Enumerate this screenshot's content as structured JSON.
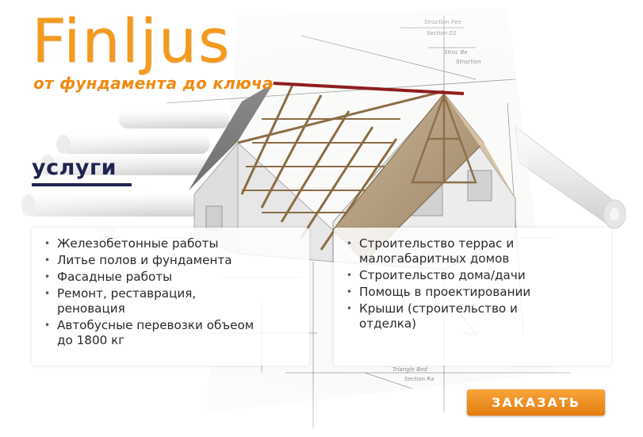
{
  "brand": {
    "title": "Finljus",
    "tagline": "от фундамента до ключа"
  },
  "services": {
    "heading": "услуги",
    "left_items": [
      "Железобетонные работы",
      "Литье полов и фундамента",
      "Фасадные работы",
      "Ремонт, реставрация,\nреновация",
      "Автобусные перевозки объеом\nдо 1800 кг"
    ],
    "right_items": [
      "Строительство террас и\nмалогабаритных домов",
      "Строительство дома/дачи",
      "Помощь в проектировании",
      "Крыши (строительство и\nотделка)"
    ]
  },
  "cta": {
    "order_label": "ЗАКАЗАТЬ"
  },
  "colors": {
    "brand_orange": "#f39a1f",
    "heading_navy": "#1f2451",
    "button_orange": "#ee8e22"
  },
  "images": {
    "background": "house-construction-blueprint-illustration"
  }
}
